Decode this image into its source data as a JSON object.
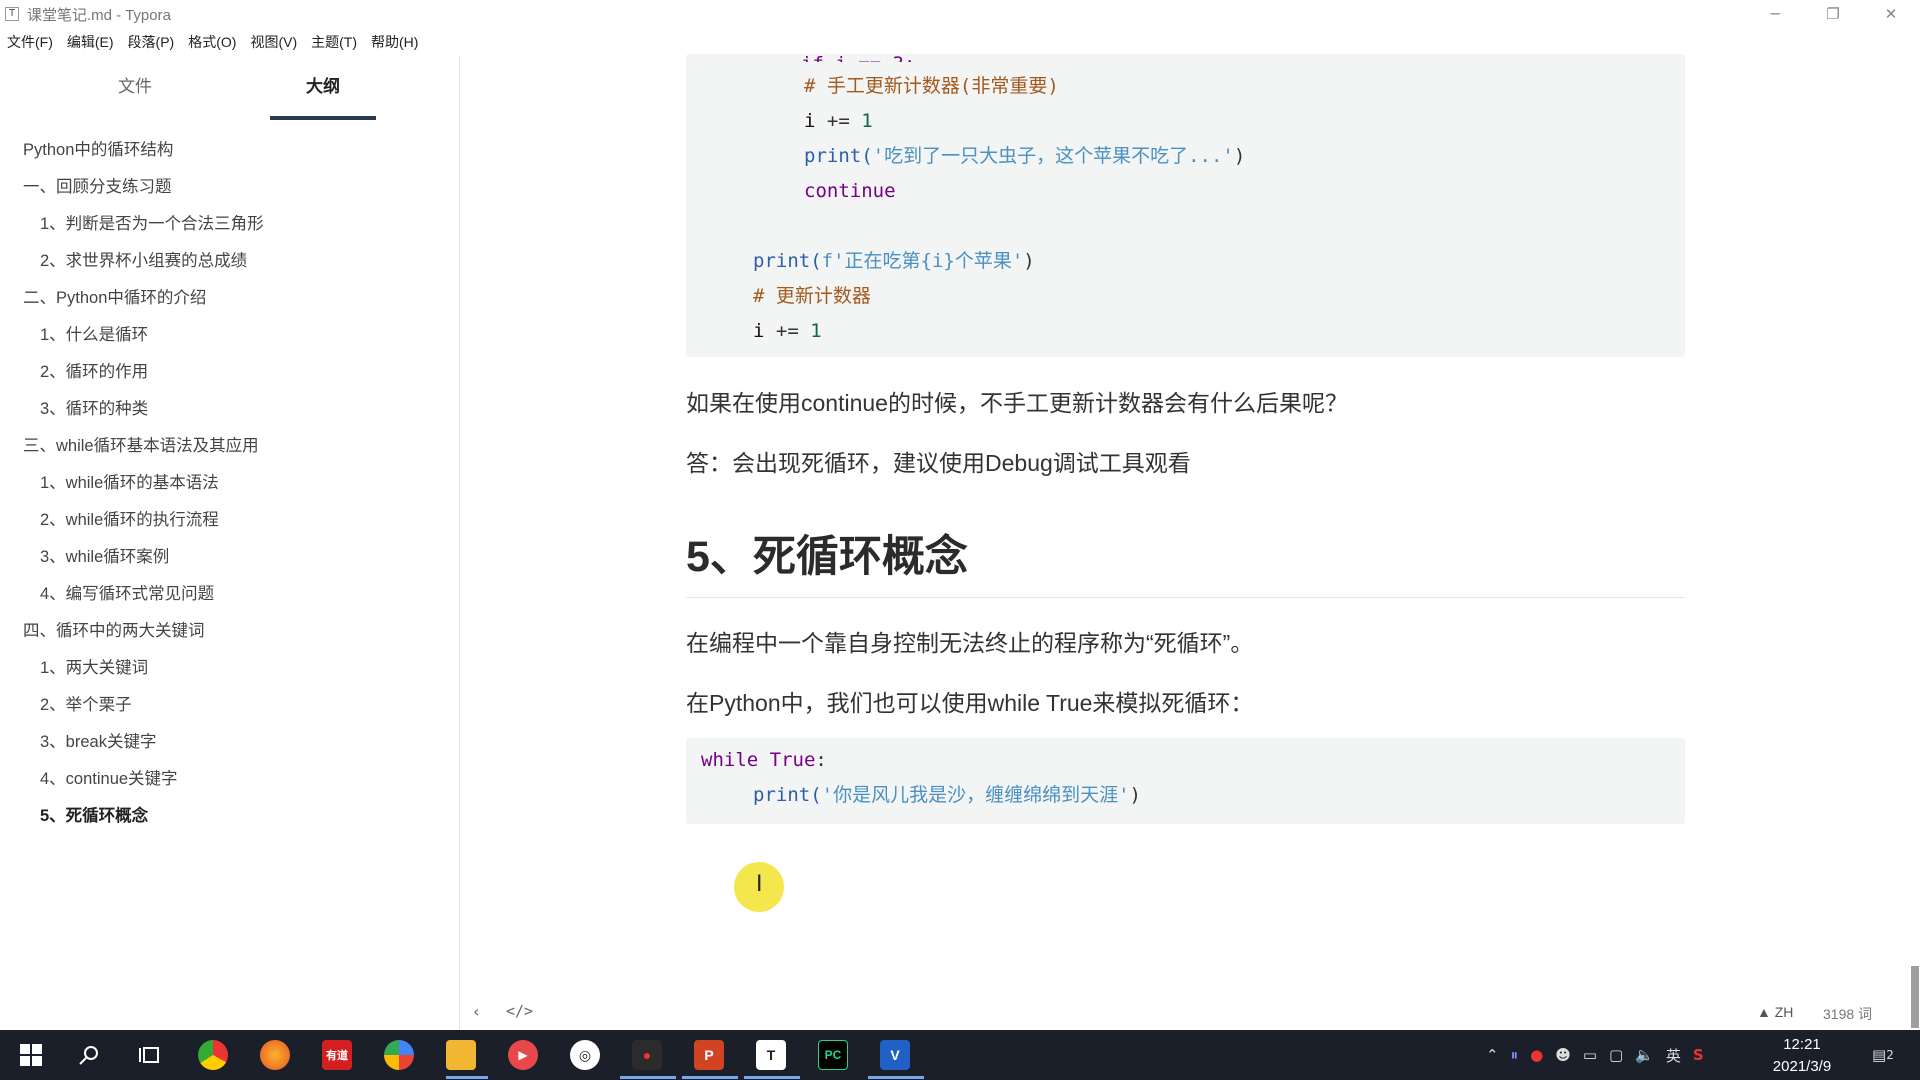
{
  "window": {
    "app_icon": "T",
    "title": "课堂笔记.md - Typora",
    "controls": [
      "─",
      "❐",
      "✕"
    ]
  },
  "menu": [
    "文件(F)",
    "编辑(E)",
    "段落(P)",
    "格式(O)",
    "视图(V)",
    "主题(T)",
    "帮助(H)"
  ],
  "sidebar": {
    "tab_files": "文件",
    "tab_outline": "大纲",
    "outline": [
      {
        "label": "Python中的循环结构",
        "level": 1
      },
      {
        "label": "一、回顾分支练习题",
        "level": 1
      },
      {
        "label": "1、判断是否为一个合法三角形",
        "level": 2
      },
      {
        "label": "2、求世界杯小组赛的总成绩",
        "level": 2
      },
      {
        "label": "二、Python中循环的介绍",
        "level": 1
      },
      {
        "label": "1、什么是循环",
        "level": 2
      },
      {
        "label": "2、循环的作用",
        "level": 2
      },
      {
        "label": "3、循环的种类",
        "level": 2
      },
      {
        "label": "三、while循环基本语法及其应用",
        "level": 1
      },
      {
        "label": "1、while循环的基本语法",
        "level": 2
      },
      {
        "label": "2、while循环的执行流程",
        "level": 2
      },
      {
        "label": "3、while循环案例",
        "level": 2
      },
      {
        "label": "4、编写循环式常见问题",
        "level": 2
      },
      {
        "label": "四、循环中的两大关键词",
        "level": 1
      },
      {
        "label": "1、两大关键词",
        "level": 2
      },
      {
        "label": "2、举个栗子",
        "level": 2
      },
      {
        "label": "3、break关键字",
        "level": 2
      },
      {
        "label": "4、continue关键字",
        "level": 2
      },
      {
        "label": "5、死循环概念",
        "level": 2,
        "active": true
      }
    ]
  },
  "editor": {
    "code1": {
      "comment1": "# 手工更新计数器(非常重要)",
      "inc1_var": "i",
      "inc1_op": " += ",
      "inc1_num": "1",
      "print1_fn": "print(",
      "print1_str": "'吃到了一只大虫子，这个苹果不吃了...'",
      "print1_close": ")",
      "continue_kw": "continue",
      "print2_fn": "print(",
      "print2_str": "f'正在吃第{i}个苹果'",
      "print2_close": ")",
      "comment2": "# 更新计数器",
      "inc2_var": "i",
      "inc2_op": " += ",
      "inc2_num": "1"
    },
    "question": "如果在使用continue的时候，不手工更新计数器会有什么后果呢？",
    "answer": "答：会出现死循环，建议使用Debug调试工具观看",
    "heading": "5、死循环概念",
    "para1": "在编程中一个靠自身控制无法终止的程序称为“死循环”。",
    "para2": "在Python中，我们也可以使用while True来模拟死循环：",
    "code2": {
      "while_kw": "while",
      "true_kw": " True",
      "colon": ":",
      "print_fn": "print(",
      "print_str": "'你是风儿我是沙，缠缠绵绵到天涯'",
      "print_close": ")"
    }
  },
  "status": {
    "back_icon": "‹",
    "source_icon": "</>",
    "lang": "ZH",
    "word_count": "3198 词"
  },
  "taskbar": {
    "clock_time": "12:21",
    "clock_date": "2021/3/9",
    "ime": "英",
    "notification_count": "2"
  },
  "colors": {
    "keyword": "#770088",
    "string": "#4a90c2",
    "comment": "#a35a1f",
    "taskbar_bg": "#1a1f2a"
  }
}
